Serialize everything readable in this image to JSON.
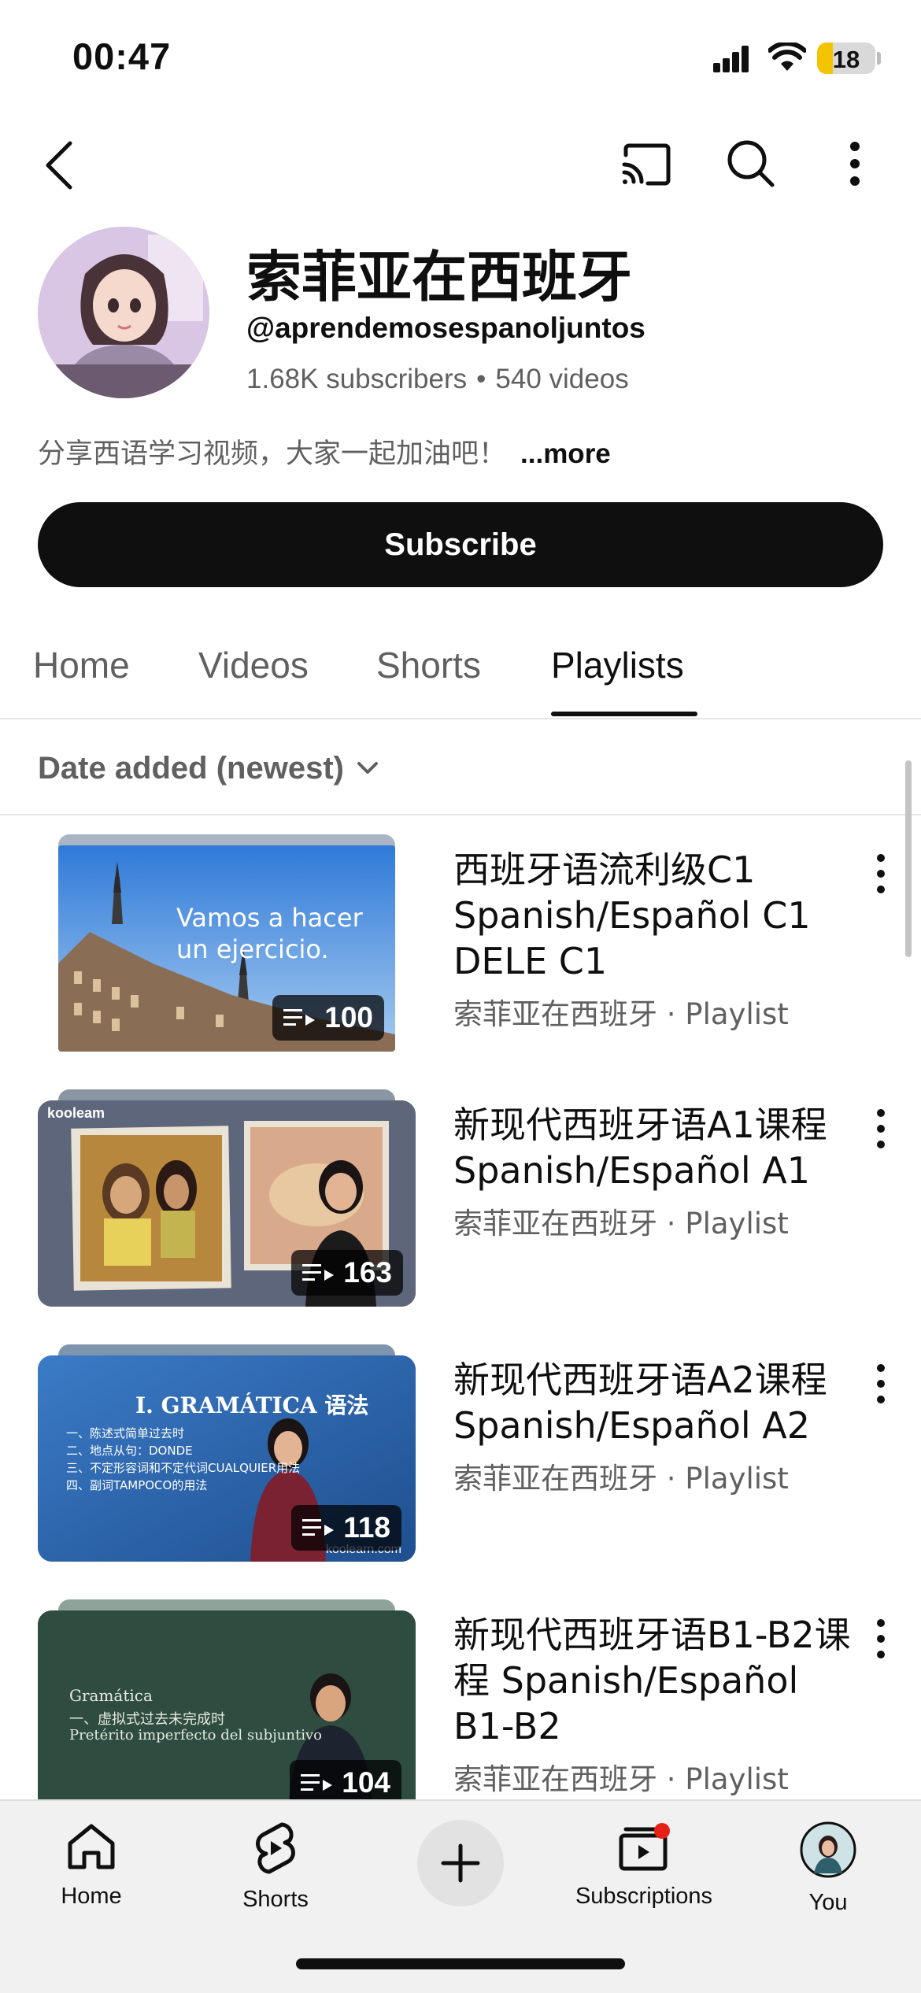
{
  "status_bar": {
    "time": "00:47",
    "battery": "18"
  },
  "channel": {
    "name": "索菲亚在西班牙",
    "handle": "@aprendemosespanoljuntos",
    "subscribers": "1.68K subscribers",
    "separator": "•",
    "videos": "540 videos",
    "description": "分享西语学习视频，大家一起加油吧！",
    "more_label": "...more",
    "subscribe_label": "Subscribe"
  },
  "tabs": [
    {
      "label": "Home"
    },
    {
      "label": "Videos"
    },
    {
      "label": "Shorts"
    },
    {
      "label": "Playlists"
    }
  ],
  "sort": {
    "label": "Date added (newest)"
  },
  "playlists": [
    {
      "title": "西班牙语流利级C1 Spanish/Español C1 DELE C1",
      "meta": "索菲亚在西班牙 · Playlist",
      "count": "100",
      "thumb_text": "Vamos a hacer un ejercicio."
    },
    {
      "title": "新现代西班牙语A1课程 Spanish/Español A1",
      "meta": "索菲亚在西班牙 · Playlist",
      "count": "163",
      "thumb_text": "kooleam"
    },
    {
      "title": "新现代西班牙语A2课程 Spanish/Español A2",
      "meta": "索菲亚在西班牙 · Playlist",
      "count": "118",
      "thumb_text": "I. GRAMÁTICA 语法",
      "thumb_lines": [
        "一、陈述式简单过去时",
        "二、地点从句：DONDE",
        "三、不定形容词和不定代词CUALQUIER用法",
        "四、副词TAMPOCO的用法"
      ],
      "thumb_footer": "koolearn.com"
    },
    {
      "title": "新现代西班牙语B1-B2课程 Spanish/Español B1-B2",
      "meta": "索菲亚在西班牙 · Playlist",
      "count": "104",
      "thumb_text": "Gramática",
      "thumb_lines": [
        "一、虚拟式过去未完成时",
        "Pretérito imperfecto del subjuntivo"
      ]
    }
  ],
  "bottom_nav": [
    {
      "label": "Home"
    },
    {
      "label": "Shorts"
    },
    {
      "label": "Subscriptions"
    },
    {
      "label": "You"
    }
  ],
  "colors": {
    "text_primary": "#0f0f0f",
    "text_secondary": "#606060",
    "notification_dot": "#e62117"
  }
}
